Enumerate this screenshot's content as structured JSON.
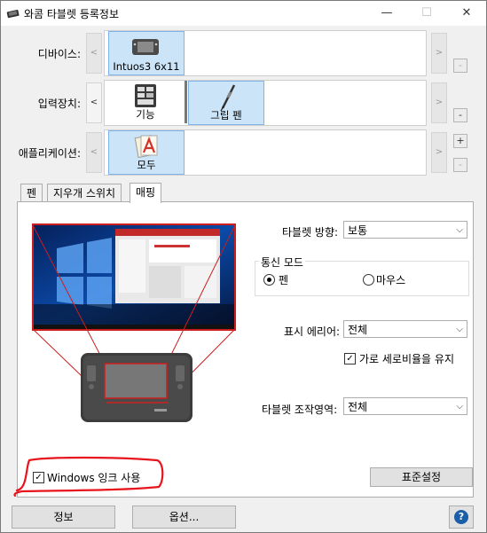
{
  "window": {
    "title": "와콤 타블렛 등록정보",
    "minimize": "—",
    "maximize": "☐",
    "close": "✕"
  },
  "rows": {
    "device": {
      "label": "디바이스:",
      "tile": "Intuos3 6x11"
    },
    "input": {
      "label": "입력장치:",
      "tiles": [
        "기능",
        "그립 펜"
      ]
    },
    "app": {
      "label": "애플리케이션:",
      "tile": "모두"
    }
  },
  "arrows": {
    "left": "<",
    "right": ">"
  },
  "row_buttons": {
    "minus": "-",
    "plus": "+"
  },
  "tabs": [
    "펜",
    "지우개 스위치",
    "매핑"
  ],
  "mapping": {
    "orientation_label": "타블렛 방향:",
    "orientation_value": "보통",
    "mode_group": "통신 모드",
    "mode_pen": "펜",
    "mode_mouse": "마우스",
    "display_label": "표시 에리어:",
    "display_value": "전체",
    "keep_ratio": "가로 세로비율을 유지",
    "tablet_area_label": "타블렛 조작영역:",
    "tablet_area_value": "전체",
    "windows_ink": "Windows 잉크 사용",
    "default_button": "표준설정"
  },
  "footer": {
    "about": "정보",
    "options": "옵션...",
    "help": "?"
  },
  "colors": {
    "selected_tile": "#cce4f7",
    "annotation_red": "#e8141c",
    "mapping_frame": "#cc1e1e",
    "help_blue": "#1b5ea8"
  }
}
